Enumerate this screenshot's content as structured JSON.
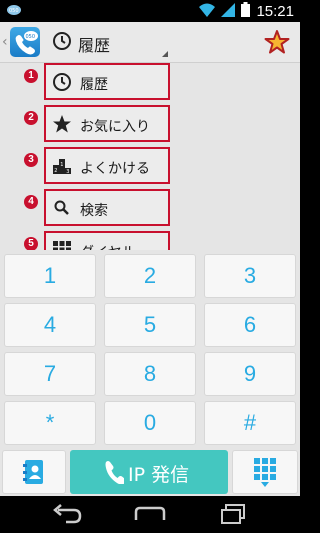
{
  "status_bar": {
    "time": "15:21"
  },
  "action_bar": {
    "title": "履歴"
  },
  "menu": {
    "items": [
      {
        "num": "1",
        "label": "履歴",
        "icon": "clock-icon"
      },
      {
        "num": "2",
        "label": "お気に入り",
        "icon": "star-icon"
      },
      {
        "num": "3",
        "label": "よくかける",
        "icon": "ranking-podium-icon"
      },
      {
        "num": "4",
        "label": "検索",
        "icon": "search-icon"
      },
      {
        "num": "5",
        "label": "ダイヤル",
        "icon": "dialpad-grid-icon"
      }
    ]
  },
  "keypad": {
    "keys": [
      "1",
      "2",
      "3",
      "4",
      "5",
      "6",
      "7",
      "8",
      "9",
      "*",
      "0",
      "#"
    ]
  },
  "bottom": {
    "call_label": "IP 発信"
  },
  "colors": {
    "accent": "#29abe2",
    "call": "#44c7c0",
    "highlight": "#c8102e"
  }
}
